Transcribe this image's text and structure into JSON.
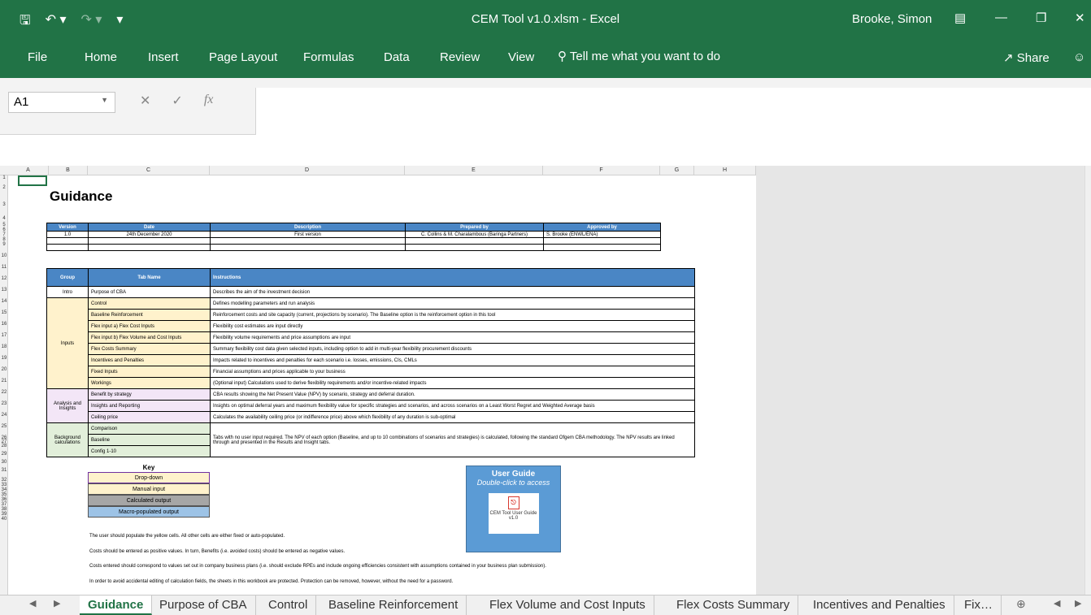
{
  "window": {
    "title": "CEM Tool v1.0.xlsm - Excel",
    "user": "Brooke, Simon"
  },
  "ribbon": {
    "tabs": [
      "File",
      "Home",
      "Insert",
      "Page Layout",
      "Formulas",
      "Data",
      "Review",
      "View"
    ],
    "tell_me": "Tell me what you want to do",
    "share": "Share"
  },
  "formula_bar": {
    "name_box": "A1",
    "fx": "fx",
    "content": ""
  },
  "columns": [
    "A",
    "B",
    "C",
    "D",
    "E",
    "F",
    "G",
    "H"
  ],
  "rows": [
    "1",
    "2",
    "3",
    "4",
    "5",
    "6",
    "7",
    "8",
    "9",
    "10",
    "11",
    "12",
    "13",
    "14",
    "15",
    "16",
    "17",
    "18",
    "19",
    "20",
    "21",
    "22",
    "23",
    "24",
    "25",
    "26",
    "27",
    "28",
    "29",
    "30",
    "31",
    "32",
    "33",
    "34",
    "35",
    "36",
    "37",
    "38",
    "39",
    "40"
  ],
  "sheet": {
    "title": "Guidance",
    "version_table": {
      "headers": [
        "Version",
        "Date",
        "Description",
        "Prepared by",
        "Approved by"
      ],
      "rows": [
        [
          "1.0",
          "24th December 2020",
          "First version",
          "C. Collins & M. Charalambous (Baringa Partners)",
          "S. Brooke (ENWL/ENA)"
        ],
        [
          "",
          "",
          "",
          "",
          ""
        ],
        [
          "",
          "",
          "",
          "",
          ""
        ]
      ]
    },
    "instructions_table": {
      "headers": [
        "Group",
        "Tab Name",
        "Instructions"
      ],
      "groups": [
        {
          "name": "Intro",
          "color": "#ffffff",
          "items": [
            {
              "tab": "Purpose of CBA",
              "instruction": "Describes the aim of the investment decision"
            }
          ]
        },
        {
          "name": "Inputs",
          "color": "#fff2cc",
          "items": [
            {
              "tab": "Control",
              "instruction": "Defines modelling parameters and run analysis"
            },
            {
              "tab": "Baseline Reinforcement",
              "instruction": "Reinforcement costs and site capacity (current, projections by scenario). The Baseline option is the reinforcement option in this tool"
            },
            {
              "tab": "Flex input a) Flex Cost Inputs",
              "instruction": "Flexibility cost estimates are input directly"
            },
            {
              "tab": "Flex input b) Flex Volume and Cost Inputs",
              "instruction": "Flexibility volume requirements and price assumptions are input"
            },
            {
              "tab": "Flex Costs Summary",
              "instruction": "Summary flexibility cost data given selected inputs, including option to add in multi-year flexibility procurement discounts"
            },
            {
              "tab": "Incentives and Penalties",
              "instruction": "Impacts related to incentives and penalties for each scenario i.e. losses, emissions, CIs, CMLs"
            },
            {
              "tab": "Fixed Inputs",
              "instruction": "Financial assumptions and prices applicable to your business"
            },
            {
              "tab": "Workings",
              "instruction": "(Optional input) Calculations used to derive flexibility requirements and/or incentive-related impacts"
            }
          ]
        },
        {
          "name": "Analysis and Insights",
          "color": "#f3e6f7",
          "items": [
            {
              "tab": "Benefit by strategy",
              "instruction": "CBA results showing the Net Present Value (NPV) by scenario, strategy and deferral duration."
            },
            {
              "tab": "Insights and Reporting",
              "instruction": "Insights on optimal deferral years and maximum flexibility value for specific strategies and scenarios, and across scenarios on a Least Worst Regret and Weighted Average basis"
            },
            {
              "tab": "Ceiling price",
              "instruction": "Calculates the availability ceiling price (or indifference price) above which flexibility of any duration is sub-optimal"
            }
          ]
        },
        {
          "name": "Background calculations",
          "color": "#e2efda",
          "items": [
            {
              "tab": "Comparison",
              "instruction": ""
            },
            {
              "tab": "Baseline",
              "instruction": ""
            },
            {
              "tab": "Config 1-10",
              "instruction": ""
            }
          ],
          "merged_instruction": "Tabs with no user input required. The NPV of each option (Baseline, and up to 10 combinations of scenarios and strategies) is calculated, following the standard Ofgem CBA methodology. The NPV results are linked through and presented in the Results and Insight tabs."
        }
      ]
    },
    "key": {
      "title": "Key",
      "items": [
        {
          "label": "Drop-down",
          "color": "#fff2cc"
        },
        {
          "label": "Manual input",
          "color": "#fff2cc"
        },
        {
          "label": "Calculated output",
          "color": "#a6a6a6"
        },
        {
          "label": "Macro-populated output",
          "color": "#9dc3e6"
        }
      ]
    },
    "notes": [
      "The user should populate the yellow cells. All other cells are either fixed or auto-populated.",
      "Costs should be entered as positive values. In turn, Benefits (i.e. avoided costs) should be entered as negative values.",
      "Costs entered should correspond to values set out in company business plans (i.e. should exclude RPEs and include ongoing efficiencies consistent with assumptions contained in your business plan submission).",
      "In order to avoid accidental editing of calculation fields, the sheets in this workbook are protected. Protection can be removed, however, without the need for a password."
    ],
    "user_guide": {
      "title": "User Guide",
      "subtitle": "Double-click to access",
      "doc_label": "CEM Tool User Guide v1.0"
    }
  },
  "sheet_tabs": [
    "Guidance",
    "Purpose of CBA",
    "Control",
    "Baseline Reinforcement",
    "Flex Volume and Cost Inputs",
    "Flex Costs Summary",
    "Incentives and Penalties",
    "Fix…"
  ],
  "active_sheet": "Guidance"
}
